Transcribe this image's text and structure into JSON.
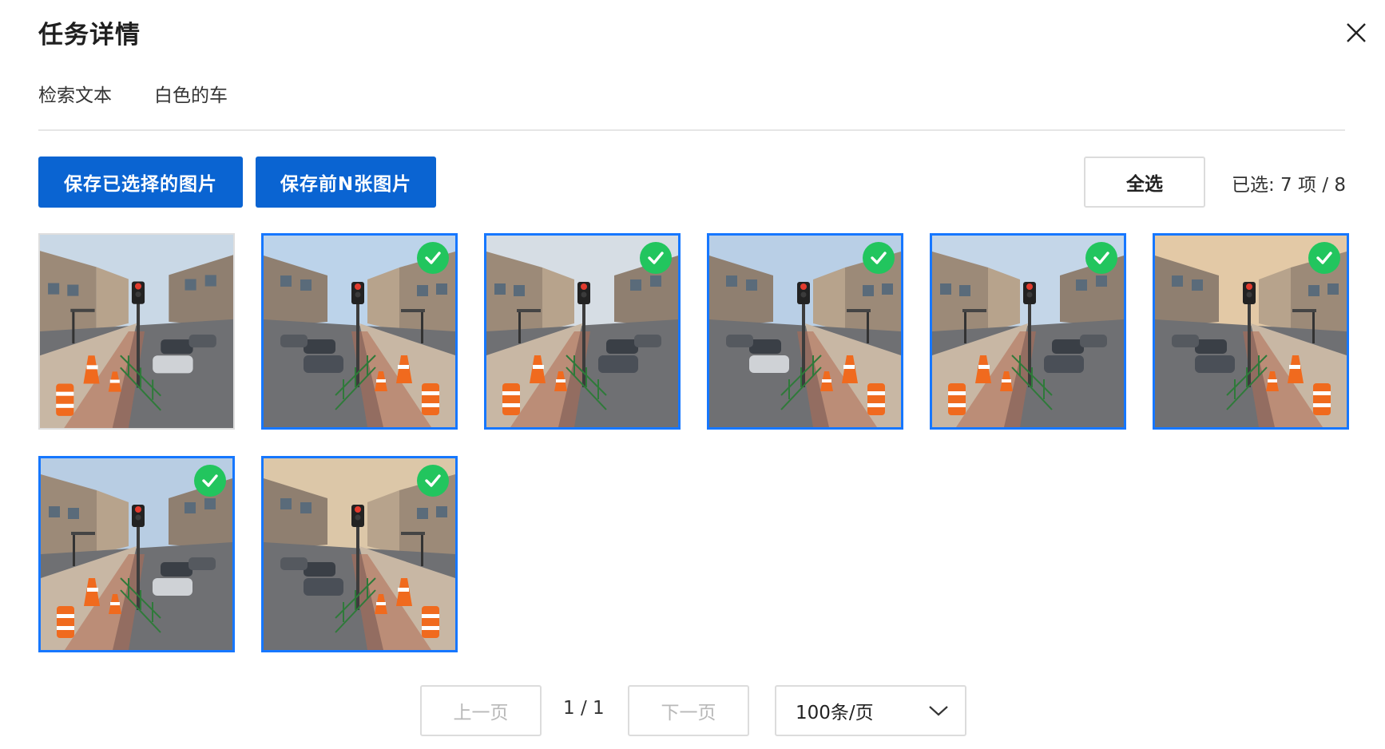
{
  "dialog": {
    "title": "任务详情",
    "close_icon": "close-icon"
  },
  "query": {
    "label": "检索文本",
    "value": "白色的车"
  },
  "toolbar": {
    "save_selected_label": "保存已选择的图片",
    "save_top_n_label": "保存前N张图片",
    "select_all_label": "全选",
    "selection_status": "已选: 7 项 / 8"
  },
  "images": [
    {
      "selected": false,
      "scene": "a"
    },
    {
      "selected": true,
      "scene": "b"
    },
    {
      "selected": true,
      "scene": "c"
    },
    {
      "selected": true,
      "scene": "d"
    },
    {
      "selected": true,
      "scene": "e"
    },
    {
      "selected": true,
      "scene": "f"
    },
    {
      "selected": true,
      "scene": "g"
    },
    {
      "selected": true,
      "scene": "h"
    }
  ],
  "pagination": {
    "prev_label": "上一页",
    "page_info": "1 / 1",
    "next_label": "下一页",
    "page_size": "100条/页"
  },
  "colors": {
    "primary": "#0a64d2",
    "selected_border": "#1677ff",
    "check_badge": "#22c55e"
  }
}
